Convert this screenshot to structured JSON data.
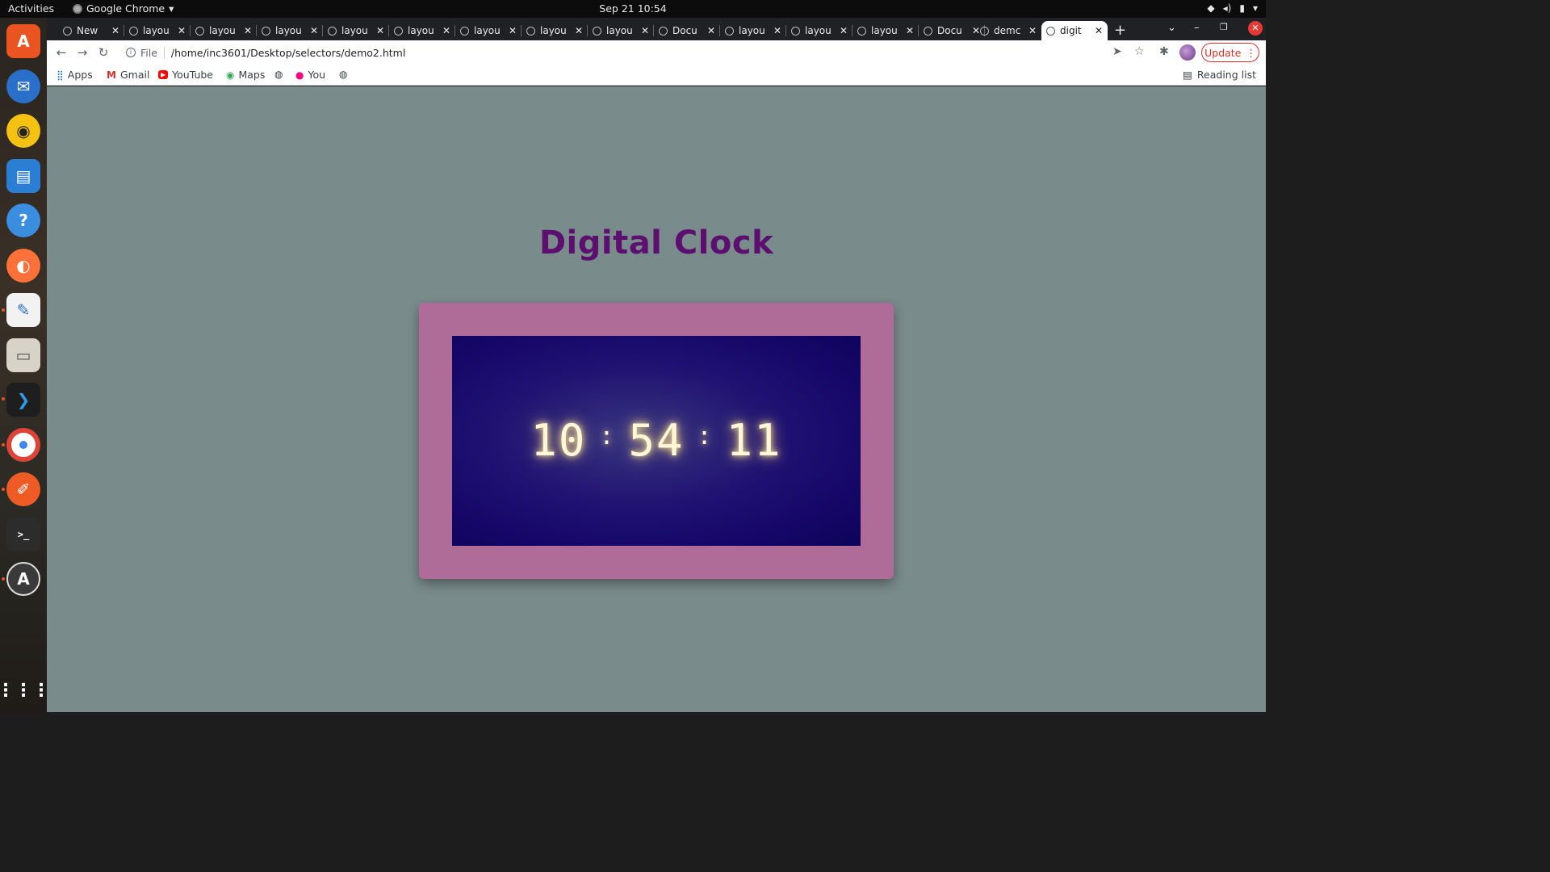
{
  "os": {
    "activities": "Activities",
    "app_name": "Google Chrome",
    "datetime": "Sep 21  10:54"
  },
  "dock": {
    "items": [
      "ubuntu-software",
      "thunderbird",
      "rhythmbox",
      "libreoffice-writer",
      "help",
      "firefox",
      "text-editor",
      "files",
      "vscode",
      "chrome",
      "postman",
      "terminal",
      "software-updater",
      "show-apps"
    ]
  },
  "browser": {
    "tabs": [
      {
        "title": "New"
      },
      {
        "title": "layou"
      },
      {
        "title": "layou"
      },
      {
        "title": "layou"
      },
      {
        "title": "layou"
      },
      {
        "title": "layou"
      },
      {
        "title": "layou"
      },
      {
        "title": "layou"
      },
      {
        "title": "layou"
      },
      {
        "title": "Docu"
      },
      {
        "title": "layou"
      },
      {
        "title": "layou"
      },
      {
        "title": "layou"
      },
      {
        "title": "Docu"
      },
      {
        "title": "demc"
      },
      {
        "title": "digit"
      }
    ],
    "active_tab_index": 15,
    "omnibox": {
      "scheme_label": "File",
      "url": "/home/inc3601/Desktop/selectors/demo2.html"
    },
    "update_label": "Update",
    "bookmarks": [
      {
        "label": "Apps",
        "icon": "apps-grid-icon"
      },
      {
        "label": "Gmail",
        "icon": "gmail-icon"
      },
      {
        "label": "YouTube",
        "icon": "youtube-icon"
      },
      {
        "label": "Maps",
        "icon": "maps-icon"
      },
      {
        "label": "",
        "icon": "globe-icon"
      },
      {
        "label": "You",
        "icon": "flickr-icon"
      },
      {
        "label": "",
        "icon": "globe-icon"
      }
    ],
    "reading_list": "Reading list"
  },
  "page": {
    "title": "Digital Clock",
    "clock": {
      "hours": "10",
      "minutes": "54",
      "seconds": "11",
      "separator": ":"
    },
    "colors": {
      "background": "#7a8b8b",
      "title": "#5c0f6e",
      "frame": "#b06c99",
      "screen": "#1a0a6b",
      "digits": "#fff7d6"
    }
  }
}
